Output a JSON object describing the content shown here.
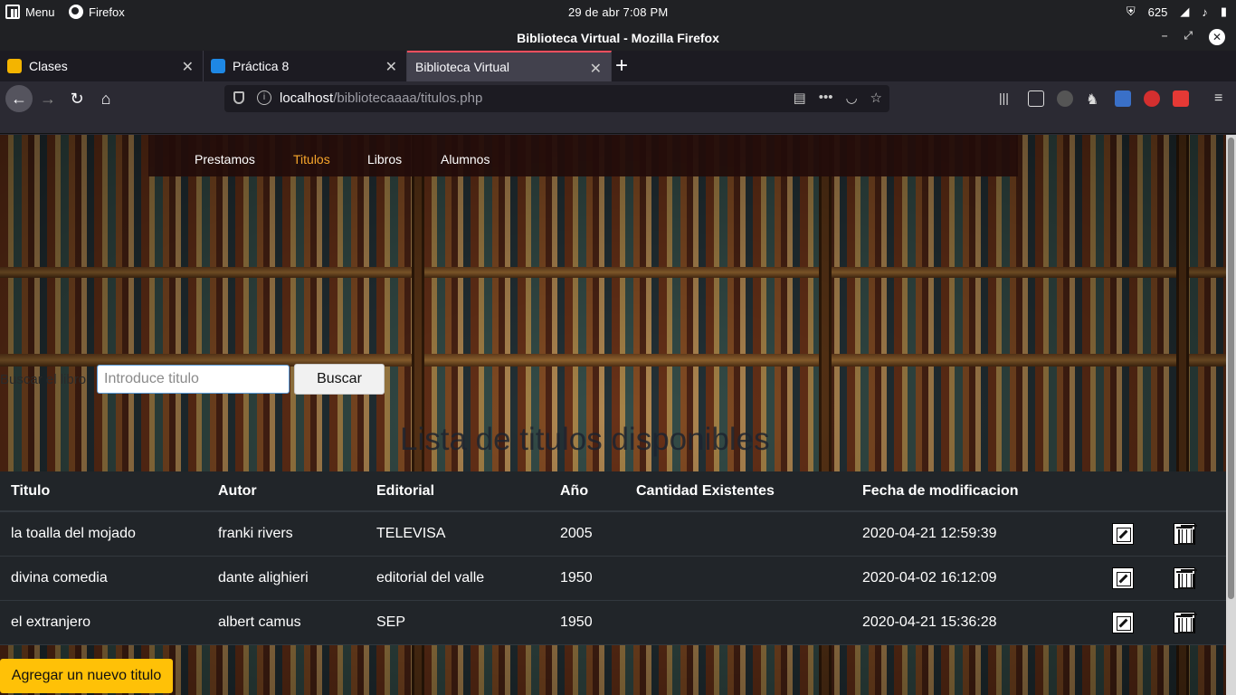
{
  "os_panel": {
    "menu_label": "Menu",
    "app_label": "Firefox",
    "clock": "29 de abr   7:08 PM",
    "tray_number": "625"
  },
  "window": {
    "title": "Biblioteca Virtual - Mozilla Firefox"
  },
  "tabs": [
    {
      "label": "Clases",
      "icon": "classroom-icon",
      "color": "#f4b400"
    },
    {
      "label": "Práctica 8",
      "icon": "classroom-icon",
      "color": "#1e88e5"
    },
    {
      "label": "Biblioteca Virtual",
      "active": true
    }
  ],
  "urlbar": {
    "host": "localhost",
    "path": "/bibliotecaaaa/titulos.php"
  },
  "nav": {
    "items": [
      "Prestamos",
      "Titulos",
      "Libros",
      "Alumnos"
    ],
    "active": "Titulos",
    "active_color": "#f7a62b"
  },
  "search": {
    "label": "Buscar el libro",
    "placeholder": "Introduce titulo",
    "button": "Buscar"
  },
  "page_title": "Lista de titulos disponibles",
  "table": {
    "headers": [
      "Titulo",
      "Autor",
      "Editorial",
      "Año",
      "Cantidad Existentes",
      "Fecha de modificacion"
    ],
    "rows": [
      [
        "la toalla del mojado",
        "franki rivers",
        "TELEVISA",
        "2005",
        "",
        "2020-04-21 12:59:39"
      ],
      [
        "divina comedia",
        "dante alighieri",
        "editorial del valle",
        "1950",
        "",
        "2020-04-02 16:12:09"
      ],
      [
        "el extranjero",
        "albert camus",
        "SEP",
        "1950",
        "",
        "2020-04-21 15:36:28"
      ]
    ]
  },
  "add_button": "Agregar un nuevo titulo",
  "colors": {
    "add_button_bg": "#ffc107",
    "table_bg": "#212529"
  }
}
